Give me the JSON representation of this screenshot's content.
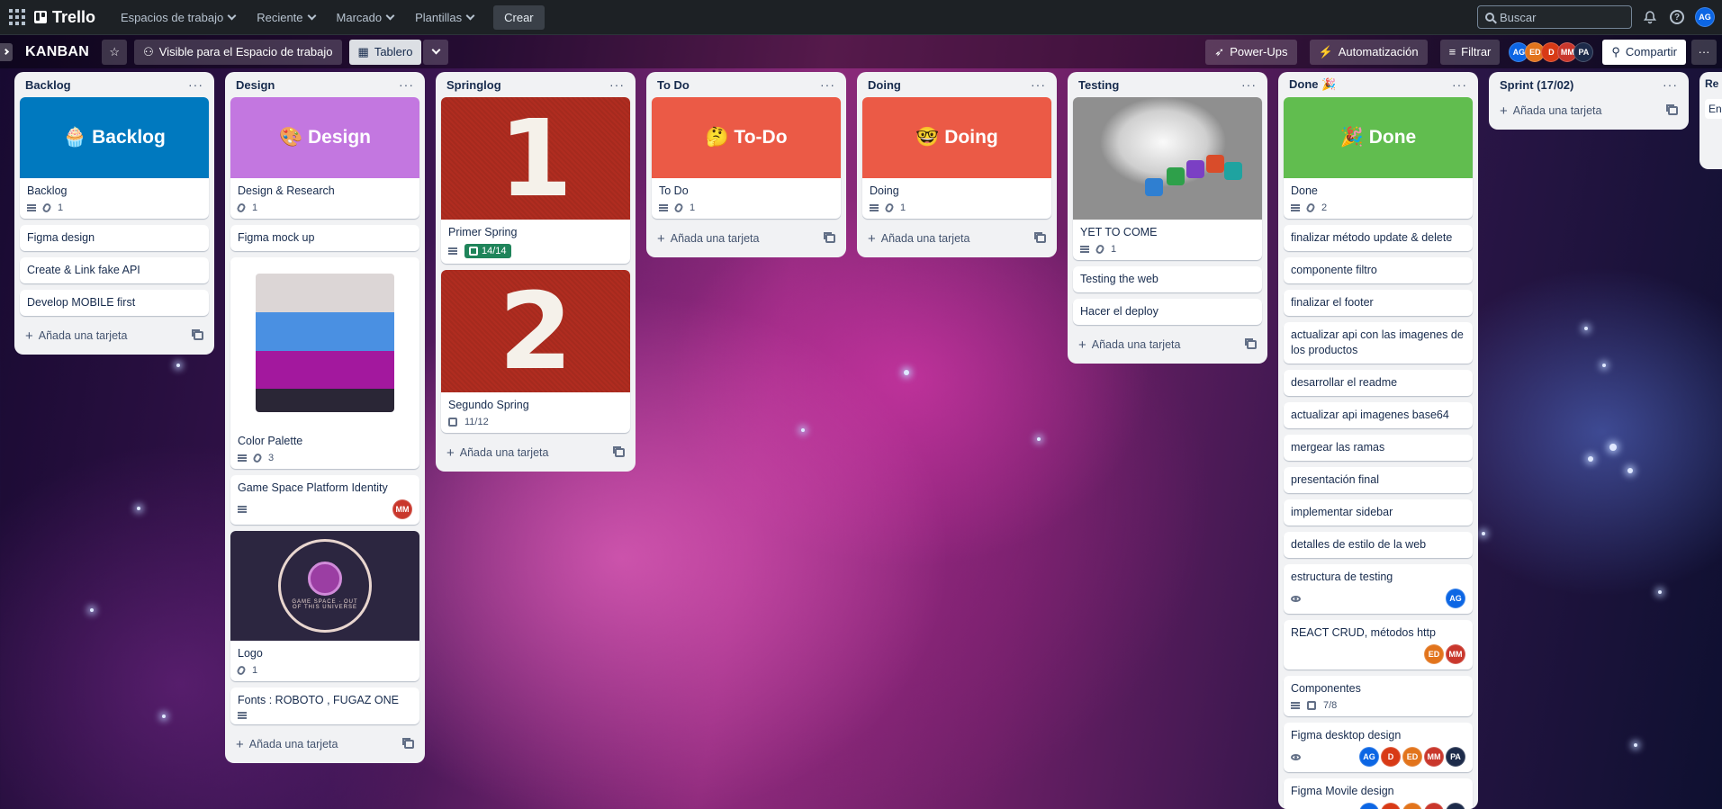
{
  "nav": {
    "logo_text": "Trello",
    "menus": [
      "Espacios de trabajo",
      "Reciente",
      "Marcado",
      "Plantillas"
    ],
    "create_label": "Crear",
    "search_placeholder": "Buscar",
    "user_initials": "AG"
  },
  "board": {
    "title": "KANBAN",
    "visibility_label": "Visible para el Espacio de trabajo",
    "view_label": "Tablero",
    "powerups_label": "Power-Ups",
    "automation_label": "Automatización",
    "filter_label": "Filtrar",
    "share_label": "Compartir",
    "members": [
      {
        "initials": "AG",
        "color": "#0c66e4"
      },
      {
        "initials": "ED",
        "color": "#e2741c"
      },
      {
        "initials": "D",
        "color": "#d83a16"
      },
      {
        "initials": "MM",
        "color": "#c9372c"
      },
      {
        "initials": "PA",
        "color": "#1d2b4a"
      }
    ]
  },
  "add_card_label": "Añada una tarjeta",
  "lists": {
    "backlog": {
      "title": "Backlog",
      "cover_text": "🧁 Backlog",
      "cover_color": "#0079bf",
      "cards": [
        {
          "title": "Backlog",
          "attachments": "1"
        },
        {
          "title": "Figma design"
        },
        {
          "title": "Create & Link fake API"
        },
        {
          "title": "Develop MOBILE first"
        }
      ]
    },
    "design": {
      "title": "Design",
      "cover_text": "🎨 Design",
      "cover_color": "#c377e0",
      "cards": [
        {
          "title": "Design & Research",
          "attachments": "1"
        },
        {
          "title": "Figma mock up"
        },
        {
          "title": "Color Palette",
          "attachments": "3"
        },
        {
          "title": "Game Space Platform Identity",
          "member": "MM"
        },
        {
          "title": "Logo",
          "attachments": "1"
        },
        {
          "title": "Fonts : ROBOTO , FUGAZ ONE"
        }
      ],
      "palette_colors": [
        "#dcd6d6",
        "#4a90e2",
        "#a3189e",
        "#2a2636"
      ],
      "logo_text": "GAME SPACE · OUT OF THIS UNIVERSE"
    },
    "springlog": {
      "title": "Springlog",
      "cards": [
        {
          "number": "1",
          "title": "Primer Spring",
          "checklist": "14/14"
        },
        {
          "number": "2",
          "title": "Segundo Spring",
          "checklist": "11/12"
        }
      ]
    },
    "todo": {
      "title": "To Do",
      "cover_text": "🤔 To-Do",
      "cover_color": "#eb5a46",
      "cards": [
        {
          "title": "To Do",
          "attachments": "1"
        }
      ]
    },
    "doing": {
      "title": "Doing",
      "cover_text": "🤓 Doing",
      "cover_color": "#eb5a46",
      "cards": [
        {
          "title": "Doing",
          "attachments": "1"
        }
      ]
    },
    "testing": {
      "title": "Testing",
      "cards": [
        {
          "title": "YET TO COME",
          "attachments": "1"
        },
        {
          "title": "Testing the web"
        },
        {
          "title": "Hacer el deploy"
        }
      ]
    },
    "done": {
      "title": "Done 🎉",
      "cover_text": "🎉 Done",
      "cover_color": "#61bd4f",
      "cards": [
        {
          "title": "Done",
          "attachments": "2"
        },
        {
          "title": "finalizar método update & delete"
        },
        {
          "title": "componente filtro"
        },
        {
          "title": "finalizar el footer"
        },
        {
          "title": "actualizar api con las imagenes de los productos"
        },
        {
          "title": "desarrollar el readme"
        },
        {
          "title": "actualizar api imagenes base64"
        },
        {
          "title": "mergear las ramas"
        },
        {
          "title": "presentación final"
        },
        {
          "title": "implementar sidebar"
        },
        {
          "title": "detalles de estilo de la web"
        },
        {
          "title": "estructura de testing",
          "members": [
            "AG"
          ]
        },
        {
          "title": "REACT CRUD, métodos http",
          "members": [
            "ED",
            "MM"
          ]
        },
        {
          "title": "Componentes",
          "checklist": "7/8"
        },
        {
          "title": "Figma desktop design",
          "members": [
            "AG",
            "D",
            "ED",
            "MM",
            "PA"
          ]
        },
        {
          "title": "Figma Movile design",
          "members": [
            "AG",
            "D",
            "ED",
            "MM",
            "PA"
          ]
        }
      ]
    },
    "sprint": {
      "title": "Sprint (17/02)"
    },
    "partial": {
      "title": "Re",
      "card_text": "Enl"
    }
  }
}
